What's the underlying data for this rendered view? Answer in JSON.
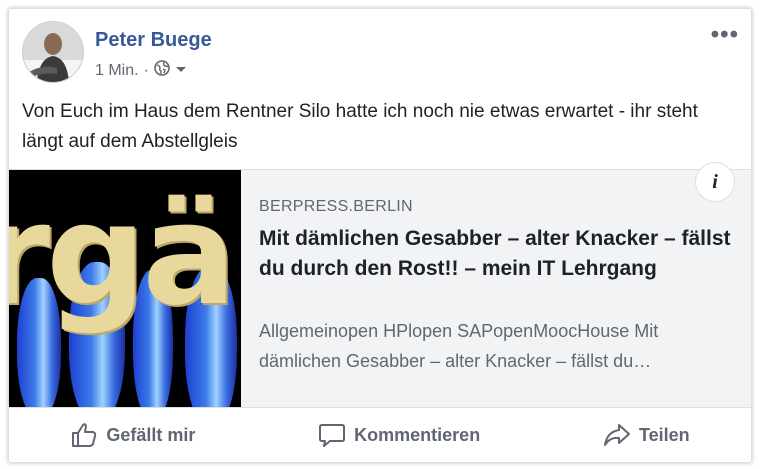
{
  "post": {
    "author": "Peter Buege",
    "time": "1 Min.",
    "separator": "·",
    "more_label": "•••",
    "text": "Von Euch im Haus dem Rentner Silo hatte ich noch nie etwas erwartet - ihr steht längt auf dem Abstellgleis"
  },
  "link": {
    "thumbnail_text": "rgä",
    "source": "BERPRESS.BERLIN",
    "title": "Mit dämlichen Gesabber – alter Knacker – fällst du durch den Rost!! – mein IT Lehrgang",
    "description": "Allgemeinopen HPlopen SAPopenMoocHouse Mit dämlichen Gesabber – alter Knacker – fällst du…",
    "info_label": "i"
  },
  "actions": {
    "like": "Gefällt mir",
    "comment": "Kommentieren",
    "share": "Teilen"
  },
  "icons": {
    "privacy": "globe-icon",
    "dropdown": "caret-down-icon",
    "like": "thumbs-up-icon",
    "comment": "speech-bubble-icon",
    "share": "share-arrow-icon"
  },
  "colors": {
    "author_link": "#385898",
    "secondary_text": "#606770",
    "preview_background": "#f2f3f5"
  }
}
